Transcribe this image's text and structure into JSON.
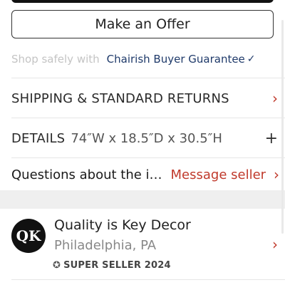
{
  "offer_button": {
    "label": "Make an Offer"
  },
  "guarantee": {
    "prefix": "Shop safely with",
    "link": "Chairish Buyer Guarantee",
    "check": "✓"
  },
  "shipping": {
    "label": "SHIPPING & STANDARD RETURNS",
    "chevron": "›"
  },
  "details": {
    "label": "DETAILS",
    "dimensions": "74″W x 18.5″D x 30.5″H",
    "plus": "+"
  },
  "questions": {
    "text": "Questions about the i…",
    "link": "Message seller",
    "chevron": "›"
  },
  "seller": {
    "avatar_text": "QK",
    "name": "Quality is Key Decor",
    "location": "Philadelphia, PA",
    "badge": "SUPER SELLER 2024",
    "chevron": "›"
  },
  "icons": {
    "badge": "award-icon",
    "chevron": "chevron-right-icon",
    "plus": "plus-icon",
    "check": "check-icon"
  },
  "colors": {
    "accent_red": "#c0392b",
    "link_blue": "#1f3a6a",
    "muted_gray": "#c4c4c4"
  }
}
